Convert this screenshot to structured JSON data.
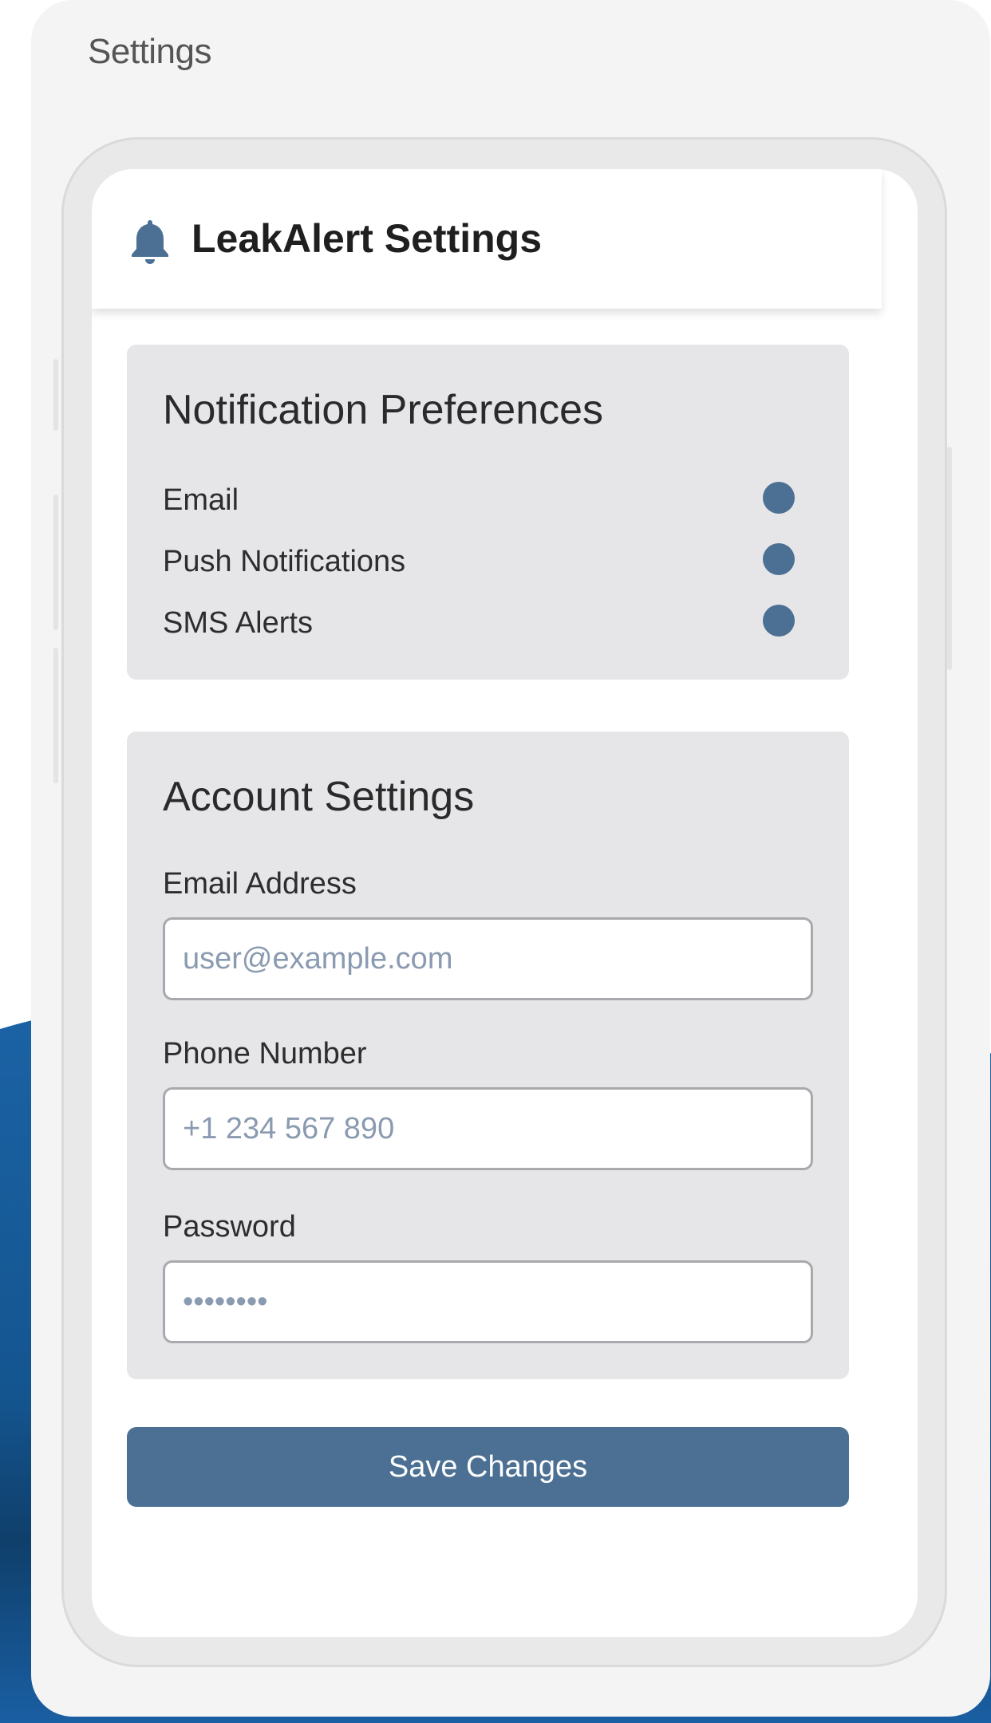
{
  "window": {
    "title": "Settings"
  },
  "header": {
    "title": "LeakAlert Settings",
    "icon": "bell-icon"
  },
  "notification_preferences": {
    "title": "Notification Preferences",
    "items": [
      {
        "label": "Email",
        "enabled": true
      },
      {
        "label": "Push Notifications",
        "enabled": true
      },
      {
        "label": "SMS Alerts",
        "enabled": true
      }
    ]
  },
  "account_settings": {
    "title": "Account Settings",
    "fields": [
      {
        "label": "Email Address",
        "value": "",
        "placeholder": "user@example.com",
        "type": "email"
      },
      {
        "label": "Phone Number",
        "value": "",
        "placeholder": "+1 234 567 890",
        "type": "tel"
      },
      {
        "label": "Password",
        "value": "",
        "placeholder": "••••••••",
        "type": "password"
      }
    ]
  },
  "actions": {
    "save_label": "Save Changes"
  },
  "colors": {
    "accent": "#4c7094",
    "panel": "#e6e6e9",
    "background_wave": "#1a5b9a"
  }
}
